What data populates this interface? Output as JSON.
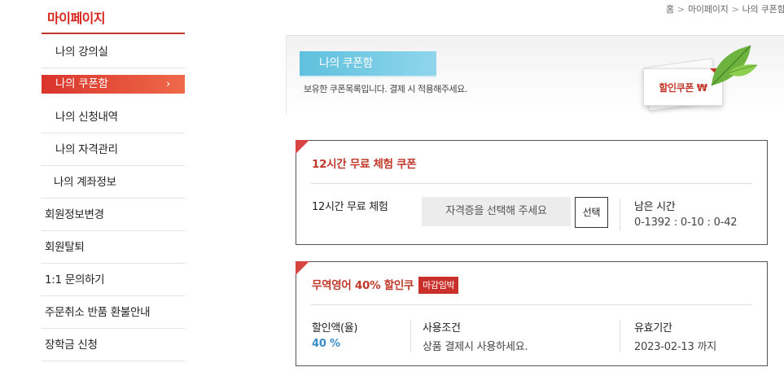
{
  "sidebar": {
    "title": "마이페이지",
    "items": [
      {
        "label": "나의 강의실"
      },
      {
        "label": "나의 쿠폰함"
      },
      {
        "label": "나의 신청내역"
      },
      {
        "label": "나의 자격관리"
      },
      {
        "label": "나의 계좌정보"
      },
      {
        "label": "회원정보변경"
      },
      {
        "label": "회원탈퇴"
      },
      {
        "label": "1:1 문의하기"
      },
      {
        "label": "주문취소 반품 환불안내"
      },
      {
        "label": "장학금 신청"
      }
    ],
    "active_chevron": "›"
  },
  "breadcrumb": {
    "home": "홈",
    "mypage": "마이페이지",
    "current": "나의 쿠폰함",
    "sep": ">"
  },
  "banner": {
    "title": "나의 쿠폰함",
    "description": "보유한 쿠폰목록입니다. 결제 시 적용해주세요.",
    "card_label": "할인쿠폰 ₩"
  },
  "coupons": [
    {
      "title": "12시간 무료 체험 쿠폰",
      "name": "12시간 무료 체험",
      "select_placeholder": "자격증을 선택해 주세요",
      "select_button": "선택",
      "remaining_label": "남은 시간",
      "remaining_value": "0-1392 : 0-10 : 0-42"
    },
    {
      "title": "무역영어 40% 할인쿠",
      "badge": "마감임박",
      "discount_label": "할인액(율)",
      "discount_value": "40 %",
      "condition_label": "사용조건",
      "condition_value": "상품 결제시 사용하세요.",
      "validity_label": "유효기간",
      "validity_value": "2023-02-13 까지"
    }
  ],
  "colors": {
    "accent": "#c0392b",
    "tab": "#5fc0de",
    "percent": "#3a8fc7"
  }
}
